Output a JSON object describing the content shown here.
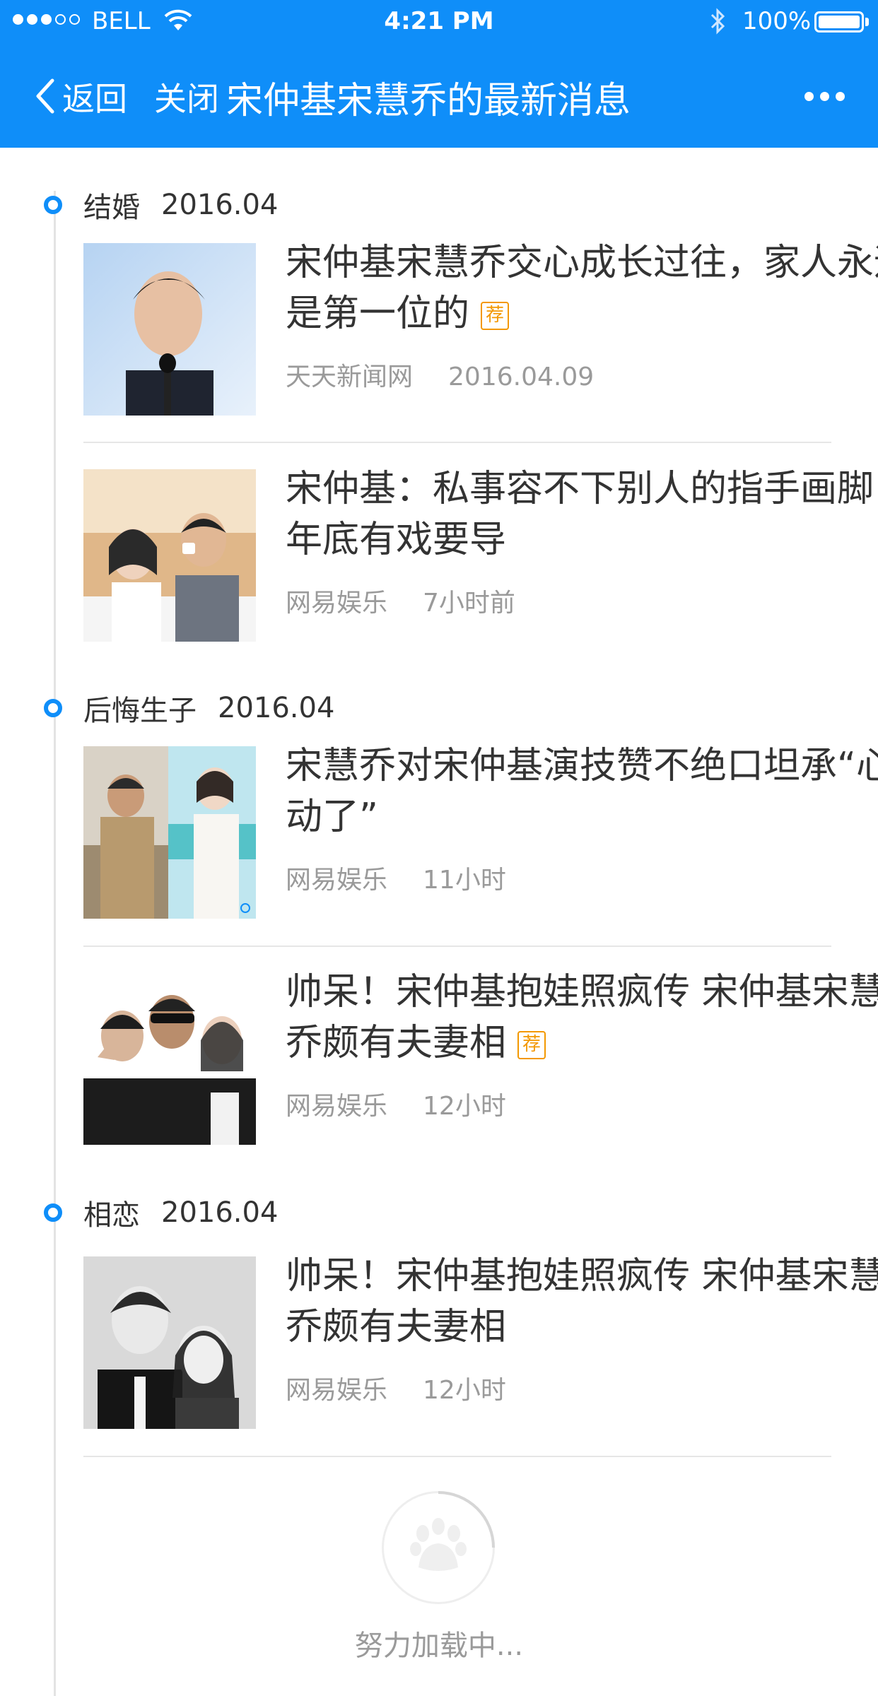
{
  "status_bar": {
    "carrier": "BELL",
    "time": "4:21 PM",
    "battery": "100%"
  },
  "nav": {
    "back_label": "返回",
    "close_label": "关闭",
    "title": "宋仲基宋慧乔的最新消息"
  },
  "sections": [
    {
      "label": "结婚",
      "date": "2016.04",
      "items": [
        {
          "title": "宋仲基宋慧乔交心成长过往，家人永远是第一位的",
          "tag": "荐",
          "source": "天天新闻网",
          "time": "2016.04.09"
        },
        {
          "title": "宋仲基：私事容不下别人的指手画脚 年底有戏要导",
          "tag": "",
          "source": "网易娱乐",
          "time": "7小时前"
        }
      ]
    },
    {
      "label": "后悔生子",
      "date": "2016.04",
      "items": [
        {
          "title": "宋慧乔对宋仲基演技赞不绝口坦承“心动了”",
          "tag": "",
          "source": "网易娱乐",
          "time": "11小时"
        },
        {
          "title": "帅呆！宋仲基抱娃照疯传 宋仲基宋慧乔颇有夫妻相",
          "tag": "荐",
          "source": "网易娱乐",
          "time": "12小时"
        }
      ]
    },
    {
      "label": "相恋",
      "date": "2016.04",
      "items": [
        {
          "title": "帅呆！宋仲基抱娃照疯传 宋仲基宋慧乔颇有夫妻相",
          "tag": "",
          "source": "网易娱乐",
          "time": "12小时"
        }
      ]
    }
  ],
  "loading_text": "努力加载中...",
  "colors": {
    "accent": "#0f8ef9",
    "tag": "#f39800",
    "meta": "#9a9a9a"
  }
}
